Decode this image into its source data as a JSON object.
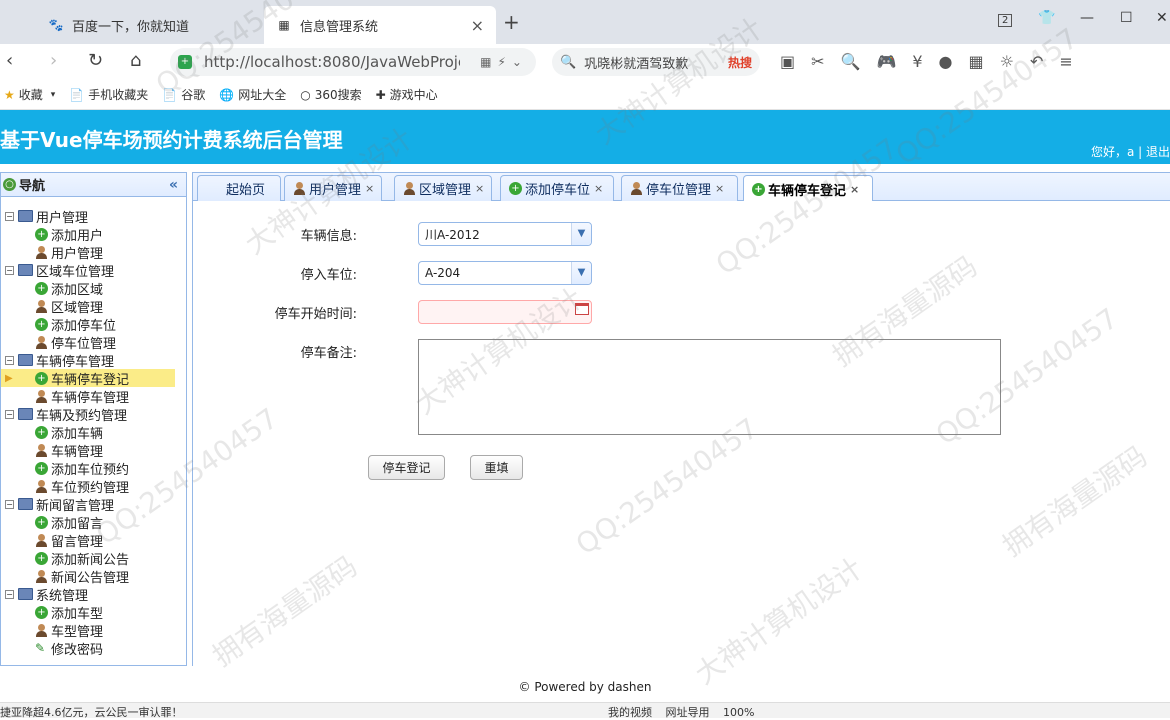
{
  "browser": {
    "tabs": [
      {
        "label": "百度一下，你就知道"
      },
      {
        "label": "信息管理系统"
      }
    ],
    "tab_count": "2",
    "url": "http://localhost:8080/JavaWebProje",
    "search_text": "巩晓彬就酒驾致歉",
    "search_badge": "热搜",
    "bookmarks": [
      "收藏",
      "手机收藏夹",
      "谷歌",
      "网址大全",
      "360搜索",
      "游戏中心"
    ]
  },
  "app": {
    "title": "基于Vue停车场预约计费系统后台管理",
    "welcome": "您好，a | 退出"
  },
  "sidebar": {
    "title": "导航",
    "groups": [
      {
        "label": "用户管理",
        "items": [
          "添加用户",
          "用户管理"
        ]
      },
      {
        "label": "区域车位管理",
        "items": [
          "添加区域",
          "区域管理",
          "添加停车位",
          "停车位管理"
        ]
      },
      {
        "label": "车辆停车管理",
        "items": [
          "车辆停车登记",
          "车辆停车管理"
        ]
      },
      {
        "label": "车辆及预约管理",
        "items": [
          "添加车辆",
          "车辆管理",
          "添加车位预约",
          "车位预约管理"
        ]
      },
      {
        "label": "新闻留言管理",
        "items": [
          "添加留言",
          "留言管理",
          "添加新闻公告",
          "新闻公告管理"
        ]
      },
      {
        "label": "系统管理",
        "items": [
          "添加车型",
          "车型管理",
          "修改密码"
        ]
      }
    ]
  },
  "panel_tabs": [
    "起始页",
    "用户管理",
    "区域管理",
    "添加停车位",
    "停车位管理",
    "车辆停车登记"
  ],
  "form": {
    "vehicle_label": "车辆信息:",
    "vehicle_value": "川A-2012",
    "slot_label": "停入车位:",
    "slot_value": "A-204",
    "start_label": "停车开始时间:",
    "note_label": "停车备注:",
    "submit_label": "停车登记",
    "reset_label": "重填"
  },
  "footer": "© Powered by dashen",
  "statusbar": {
    "news": "捷亚降超4.6亿元，云公民一审认罪！",
    "right": "我的视频 网址导用 100%"
  },
  "watermarks": [
    "QQ:254540457",
    "拥有海量源码",
    "大神计算机设计"
  ],
  "colors": {
    "header": "#14aee6",
    "border": "#95b8e7",
    "selected": "#fbec88"
  }
}
